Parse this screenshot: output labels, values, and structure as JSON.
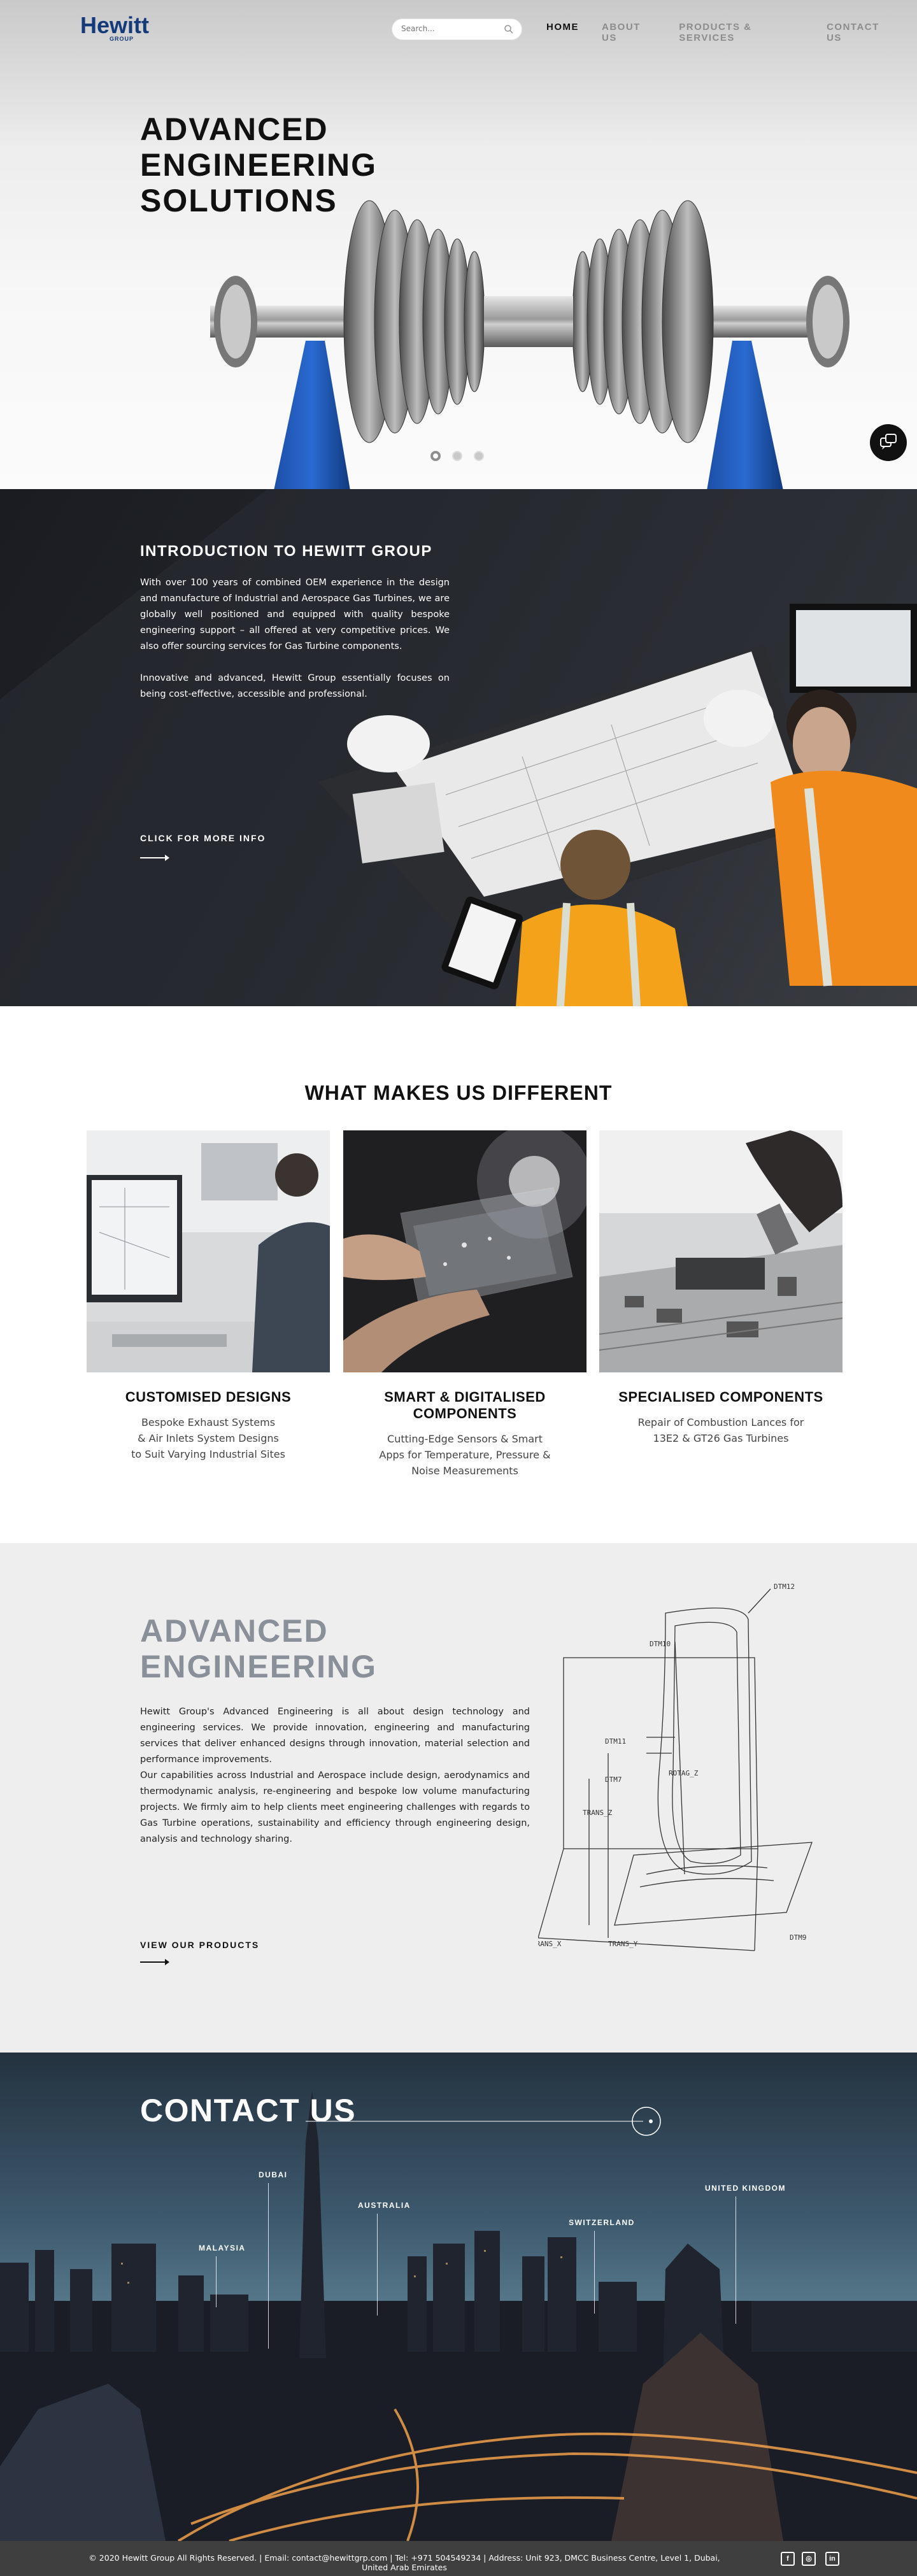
{
  "header": {
    "logo": "Hewitt",
    "logo_sub": "GROUP",
    "search_placeholder": "Search...",
    "nav": [
      "HOME",
      "ABOUT US",
      "PRODUCTS & SERVICES",
      "CONTACT US"
    ],
    "active_nav": "HOME"
  },
  "hero": {
    "title_lines": [
      "ADVANCED",
      "ENGINEERING",
      "SOLUTIONS"
    ],
    "slides": 3,
    "active_slide": 1
  },
  "intro": {
    "heading": "INTRODUCTION TO HEWITT GROUP",
    "paragraph1": "With over 100 years of combined OEM experience in the design and manufacture of Industrial and Aerospace Gas Turbines, we are globally well positioned and equipped with quality bespoke engineering support – all offered at very competitive prices. We also offer sourcing services for Gas Turbine components.",
    "paragraph2": "Innovative and advanced, Hewitt Group essentially focuses on being cost-effective, accessible and professional.",
    "link": "CLICK FOR MORE INFO"
  },
  "different": {
    "title": "WHAT MAKES US DIFFERENT",
    "cards": [
      {
        "title": "CUSTOMISED DESIGNS",
        "lines": [
          "Bespoke Exhaust Systems",
          "& Air Inlets System Designs",
          "to Suit Varying Industrial Sites"
        ]
      },
      {
        "title": "SMART & DIGITALISED COMPONENTS",
        "lines": [
          "Cutting-Edge Sensors & Smart",
          "Apps for Temperature, Pressure &",
          "Noise Measurements"
        ]
      },
      {
        "title": "SPECIALISED COMPONENTS",
        "lines": [
          "Repair of Combustion Lances for",
          "13E2 & GT26 Gas Turbines"
        ]
      }
    ]
  },
  "advanced": {
    "title_lines": [
      "ADVANCED",
      "ENGINEERING"
    ],
    "paragraph1": "Hewitt Group's Advanced Engineering is all about design technology and engineering services. We provide innovation, engineering and manufacturing services that deliver enhanced designs through innovation, material selection and performance improvements.",
    "paragraph2": "Our capabilities across Industrial and Aerospace include design, aerodynamics and thermodynamic analysis, re-engineering and bespoke low volume manufacturing projects. We firmly aim to help clients meet engineering challenges with regards to Gas Turbine operations, sustainability and efficiency through engineering design, analysis and technology sharing.",
    "link": "VIEW OUR PRODUCTS",
    "diagram_labels": [
      "DTM12",
      "DTM10",
      "DTM11",
      "ROTAG_Z",
      "DTM7",
      "TRANS_Z",
      "TRANS_X",
      "TRANS_Y",
      "DTM9"
    ]
  },
  "contact": {
    "title": "CONTACT US",
    "locations": [
      "DUBAI",
      "AUSTRALIA",
      "MALAYSIA",
      "SWITZERLAND",
      "UNITED KINGDOM"
    ]
  },
  "footer": {
    "text": "© 2020 Hewitt Group All Rights Reserved.  |  Email: contact@hewittgrp.com  |  Tel: +971 504549234  |  Address: Unit 923, DMCC Business Centre, Level 1, Dubai, United Arab Emirates",
    "social": [
      "f",
      "◎",
      "in"
    ]
  },
  "colors": {
    "brand": "#143a7a",
    "footer": "#3f3f3f",
    "muted_title": "#8a9099"
  }
}
